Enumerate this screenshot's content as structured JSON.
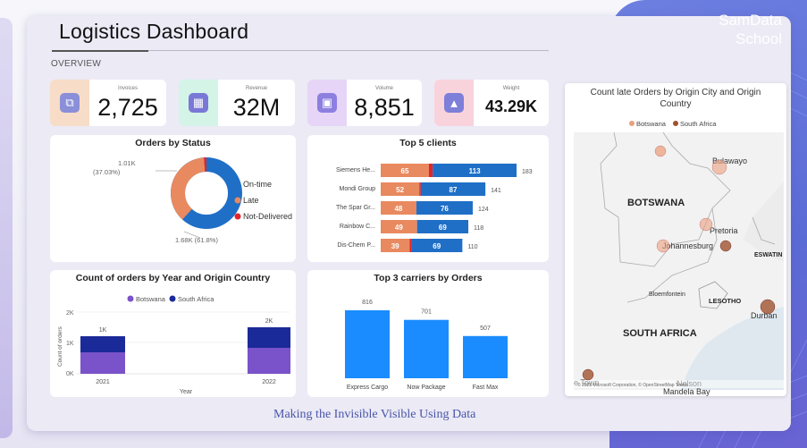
{
  "header": {
    "title": "Logistics Dashboard",
    "overview": "OVERVIEW",
    "brand_line1": "SamData",
    "brand_line2": "School"
  },
  "kpis": [
    {
      "label": "Invoices",
      "value": "2,725",
      "icon": "copy-icon",
      "color": "#f7dcc8",
      "icon_color": "#8a8fd8"
    },
    {
      "label": "Revenue",
      "value": "32M",
      "icon": "cash-register-icon",
      "color": "#d3f4e6",
      "icon_color": "#7a78d6"
    },
    {
      "label": "Volume",
      "value": "8,851",
      "icon": "box-icon",
      "color": "#e6d5f6",
      "icon_color": "#8c7fe0"
    },
    {
      "label": "Weight",
      "value": "43.29K",
      "icon": "weight-icon",
      "color": "#f9d3dc",
      "icon_color": "#7d7fd9"
    }
  ],
  "status_chart": {
    "title": "Orders by Status",
    "legend": [
      "On-time",
      "Late",
      "Not-Delivered"
    ],
    "colors": [
      "#1f6fc7",
      "#e9895f",
      "#e3242b"
    ],
    "values": [
      1.68,
      1.01,
      0.03
    ],
    "label_late_1": "1.01K",
    "label_late_2": "(37.03%)",
    "label_ontime": "1.68K (61.8%)"
  },
  "clients_chart": {
    "title": "Top 5 clients",
    "rows": [
      {
        "name": "Siemens He...",
        "late": 65,
        "ontime": 113,
        "total": "183"
      },
      {
        "name": "Mondi Group",
        "late": 52,
        "ontime": 87,
        "total": "141"
      },
      {
        "name": "The Spar Gr...",
        "late": 48,
        "ontime": 76,
        "total": "124"
      },
      {
        "name": "Rainbow C...",
        "late": 49,
        "ontime": 69,
        "total": "118"
      },
      {
        "name": "Dis-Chem P...",
        "late": 39,
        "ontime": 69,
        "total": "110"
      }
    ]
  },
  "year_chart": {
    "title": "Count of orders by Year and Origin Country",
    "legend": [
      "Botswana",
      "South Africa"
    ],
    "colors": [
      "#7a52c9",
      "#1b2a99"
    ],
    "yticks": [
      "2K",
      "1K",
      "0K"
    ],
    "ylabel": "Count of orders",
    "xlabel": "Year",
    "years": [
      "2021",
      "2022"
    ],
    "bar_labels": [
      "1K",
      "2K"
    ]
  },
  "carriers_chart": {
    "title": "Top 3 carriers by Orders",
    "bars": [
      {
        "name": "Express Cargo",
        "value": 816,
        "label": "816"
      },
      {
        "name": "Now Package",
        "value": 701,
        "label": "701"
      },
      {
        "name": "Fast Max",
        "value": 507,
        "label": "507"
      }
    ]
  },
  "map": {
    "title_line1": "Count late Orders by Origin City and Origin",
    "title_line2": "Country",
    "legend": [
      "Botswana",
      "South Africa"
    ],
    "labels": {
      "botswana": "BOTSWANA",
      "south_africa": "SOUTH AFRICA",
      "bulawayo": "Bulawayo",
      "pretoria": "Pretoria",
      "johannesburg": "Johannesburg",
      "eswatini": "ESWATIN",
      "bloemfontein": "Bloemfontein",
      "lesotho": "LESOTHO",
      "durban": "Durban",
      "nelson": "Nelson",
      "mandela": "Mandela Bay",
      "capetown": "e Town"
    },
    "attribution": "© 2025 Microsoft Corporation, © OpenStreetMap Terms"
  },
  "footer": "Making the Invisible Visible Using Data"
}
